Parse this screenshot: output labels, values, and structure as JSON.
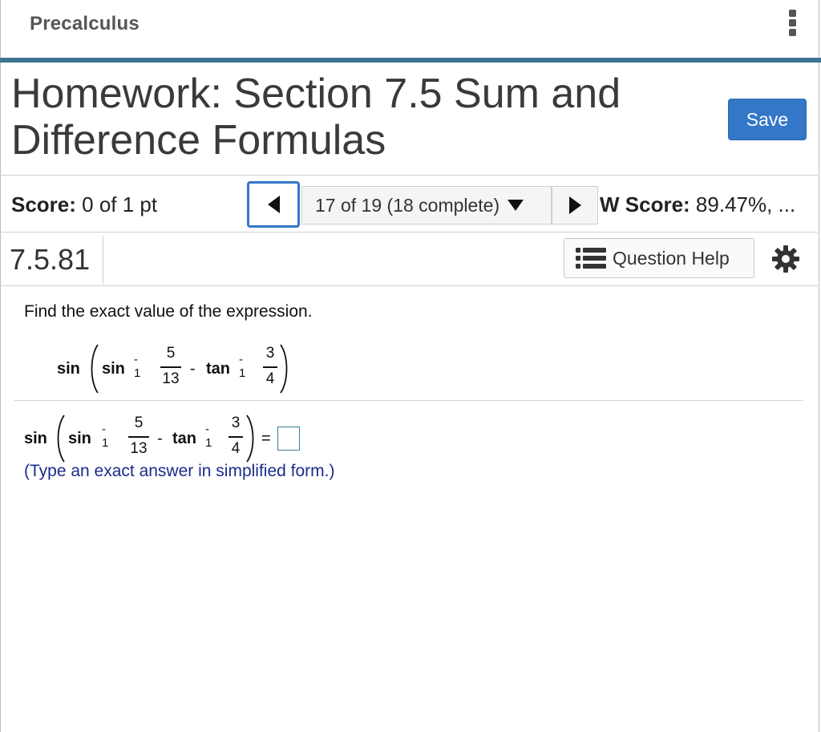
{
  "header": {
    "course": "Precalculus",
    "menu_icon": "kebab-vertical-icon"
  },
  "title": {
    "text": "Homework: Section 7.5 Sum and Difference Formulas"
  },
  "toolbar": {
    "save_label": "Save"
  },
  "score_bar": {
    "score_label": "Score:",
    "score_value": "0 of 1 pt",
    "navigator_text": "17 of 19 (18 complete)",
    "hw_score_label": "W Score:",
    "hw_score_value": "89.47%, ..."
  },
  "question_bar": {
    "question_id": "7.5.81",
    "help_label": "Question Help"
  },
  "question": {
    "prompt": "Find the exact value of the expression.",
    "expression": {
      "outer_fn": "sin",
      "fn1": "sin",
      "fn1_sup": "- 1",
      "frac1_num": "5",
      "frac1_den": "13",
      "op": "-",
      "fn2": "tan",
      "fn2_sup": "- 1",
      "frac2_num": "3",
      "frac2_den": "4"
    },
    "equals": "=",
    "hint": "(Type an exact answer in simplified form.)"
  },
  "colors": {
    "accent": "#3477c9",
    "rule": "#3b7591",
    "hint_text": "#1a2c8c"
  }
}
